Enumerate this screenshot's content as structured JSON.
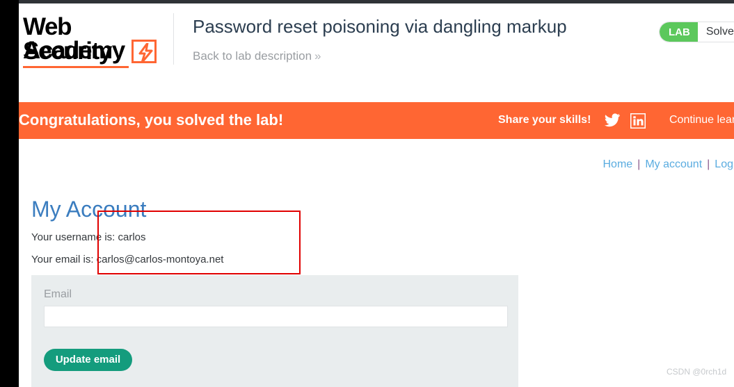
{
  "browser": {
    "top_strip_color": "#2f3337",
    "gutter_color": "#000000"
  },
  "header": {
    "logo": {
      "line1": "Web Security",
      "line2": "Academy",
      "bolt_icon": "lightning-bolt-icon",
      "accent_color": "#ff6633"
    },
    "lab_title": "Password reset poisoning via dangling markup",
    "back_link": "Back to lab description",
    "back_link_chevron": "»",
    "status": {
      "tag": "LAB",
      "state": "Solved",
      "tag_color": "#5cc85c"
    }
  },
  "banner": {
    "title": "Congratulations, you solved the lab!",
    "share_label": "Share your skills!",
    "twitter_icon": "twitter-icon",
    "linkedin_icon": "linkedin-icon",
    "continue_label": "Continue lear",
    "background_color": "#ff6633"
  },
  "topnav": {
    "items": [
      {
        "label": "Home"
      },
      {
        "label": "My account"
      },
      {
        "label": "Log"
      }
    ],
    "separator": "|",
    "link_color": "#5aace0"
  },
  "main": {
    "page_title": "My Account",
    "username_line": "Your username is: carlos",
    "email_line": "Your email is: carlos@carlos-montoya.net",
    "username": "carlos",
    "email": "carlos@carlos-montoya.net"
  },
  "annotation": {
    "shape": "rectangle",
    "color": "#e00000"
  },
  "form": {
    "label": "Email",
    "input_value": "",
    "input_placeholder": "",
    "submit_label": "Update email",
    "submit_color": "#149c7d",
    "panel_color": "#e9edee"
  },
  "watermark": {
    "text": "CSDN @0rch1d"
  }
}
